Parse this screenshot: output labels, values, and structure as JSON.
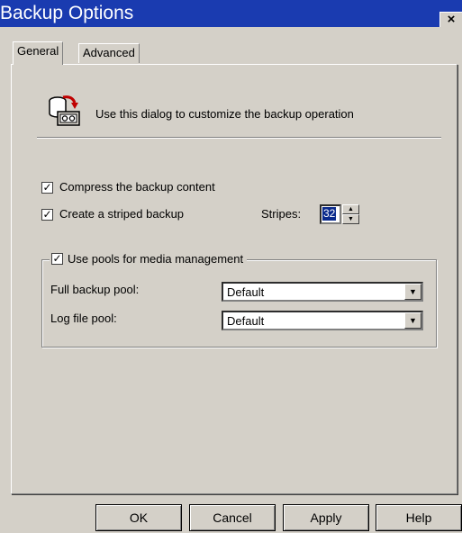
{
  "window": {
    "title": "Backup Options",
    "close_label": "×"
  },
  "tabs": [
    {
      "label": "General",
      "active": true
    },
    {
      "label": "Advanced",
      "active": false
    }
  ],
  "general": {
    "icon": "backup-tape-icon",
    "description": "Use this dialog to customize the backup operation",
    "compress": {
      "label": "Compress the backup content",
      "checked": true
    },
    "striped": {
      "label": "Create a striped backup",
      "checked": true
    },
    "stripes": {
      "label": "Stripes:",
      "value": "32"
    },
    "pools_group": {
      "legend": "Use pools for media management",
      "checked": true,
      "full_backup_pool": {
        "label": "Full backup pool:",
        "value": "Default"
      },
      "log_file_pool": {
        "label": "Log file pool:",
        "value": "Default"
      }
    }
  },
  "buttons": {
    "ok": "OK",
    "cancel": "Cancel",
    "apply": "Apply",
    "help": "Help"
  },
  "colors": {
    "titlebar": "#1a3bb0",
    "face": "#d4d0c8",
    "selection": "#0a2a8c"
  }
}
